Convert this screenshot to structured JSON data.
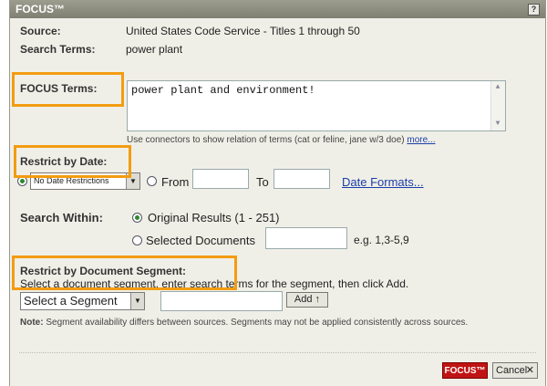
{
  "dialog": {
    "title": "FOCUS™",
    "help_label": "?"
  },
  "source": {
    "label": "Source:",
    "value": "United States Code Service - Titles 1 through 50"
  },
  "search_terms": {
    "label": "Search Terms:",
    "value": "power plant"
  },
  "focus_terms": {
    "label": "FOCUS Terms:",
    "value": "power plant and environment!",
    "hint": "Use connectors to show relation of terms (cat or feline, jane w/3 doe)",
    "more_link": "more..."
  },
  "restrict_date": {
    "label": "Restrict by Date:",
    "select_value": "No Date Restrictions",
    "from_label": "From",
    "to_label": "To",
    "formats_link": "Date Formats..."
  },
  "search_within": {
    "label": "Search Within:",
    "option_original": "Original Results (1 - 251)",
    "option_selected": "Selected Documents",
    "example": "e.g. 1,3-5,9"
  },
  "segment": {
    "label": "Restrict by Document Segment:",
    "instructions": "Select a document segment, enter search terms for the segment, then click Add.",
    "select_value": "Select a Segment",
    "add_label": "Add ↑",
    "note_bold": "Note:",
    "note_text": " Segment availability differs between sources. Segments may not be applied consistently across sources."
  },
  "footer": {
    "focus_button": "FOCUS™",
    "cancel_button": "Cancel"
  },
  "colors": {
    "highlight": "#f39c11",
    "link": "#1a3ea8",
    "focus_button": "#c01414"
  }
}
